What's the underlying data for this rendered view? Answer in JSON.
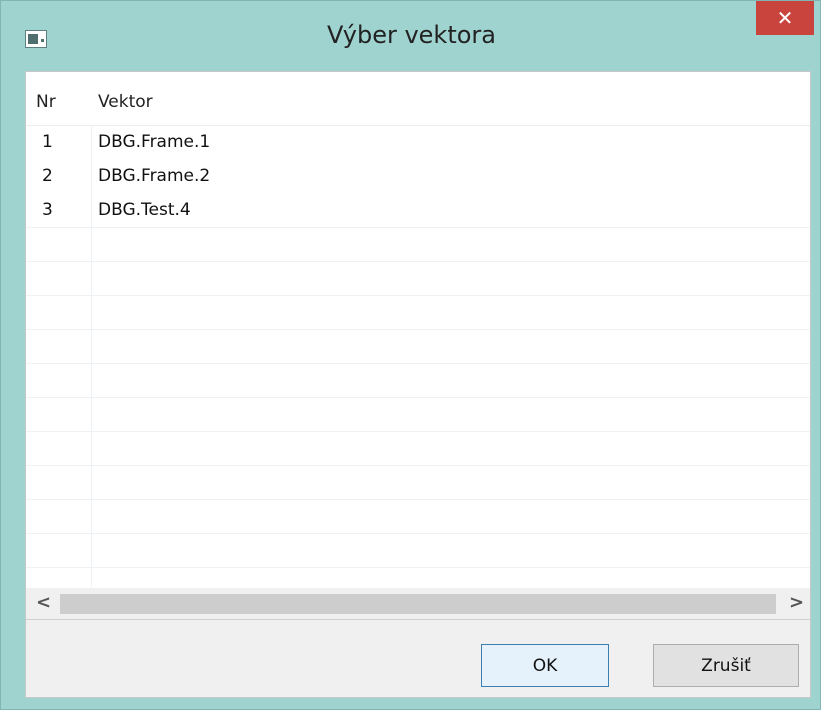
{
  "window": {
    "title": "Výber vektora",
    "close_glyph": "✕"
  },
  "table": {
    "columns": [
      "Nr",
      "Vektor"
    ],
    "rows": [
      {
        "nr": "1",
        "vektor": "DBG.Frame.1"
      },
      {
        "nr": "2",
        "vektor": "DBG.Frame.2"
      },
      {
        "nr": "3",
        "vektor": "DBG.Test.4"
      }
    ]
  },
  "scrollbar": {
    "left_glyph": "<",
    "right_glyph": ">"
  },
  "buttons": {
    "ok": "OK",
    "cancel": "Zrušiť"
  }
}
